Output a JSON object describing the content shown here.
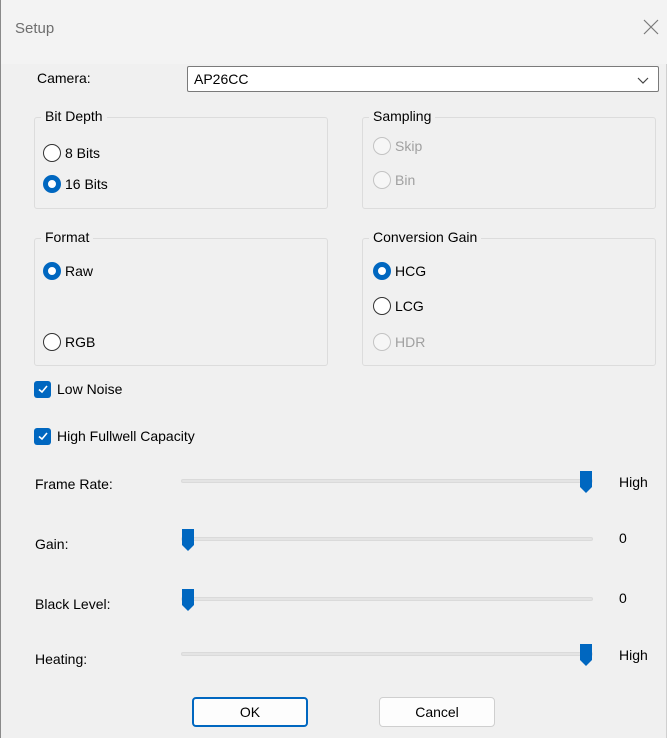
{
  "window": {
    "title": "Setup"
  },
  "camera": {
    "label": "Camera:",
    "value": "AP26CC"
  },
  "bit_depth": {
    "legend": "Bit Depth",
    "options": [
      {
        "label": "8 Bits",
        "checked": false
      },
      {
        "label": "16 Bits",
        "checked": true
      }
    ]
  },
  "sampling": {
    "legend": "Sampling",
    "options": [
      {
        "label": "Skip",
        "enabled": false
      },
      {
        "label": "Bin",
        "enabled": false
      }
    ]
  },
  "format": {
    "legend": "Format",
    "options": [
      {
        "label": "Raw",
        "checked": true
      },
      {
        "label": "RGB",
        "checked": false
      }
    ]
  },
  "conversion_gain": {
    "legend": "Conversion Gain",
    "options": [
      {
        "label": "HCG",
        "checked": true
      },
      {
        "label": "LCG",
        "checked": false
      },
      {
        "label": "HDR",
        "checked": false,
        "enabled": false
      }
    ]
  },
  "checkboxes": {
    "low_noise": {
      "label": "Low Noise",
      "checked": true
    },
    "high_fullwell": {
      "label": "High Fullwell Capacity",
      "checked": true
    }
  },
  "sliders": {
    "frame_rate": {
      "label": "Frame Rate:",
      "value_text": "High",
      "level": 1.0
    },
    "gain": {
      "label": "Gain:",
      "value_text": "0",
      "level": 0.0
    },
    "black_level": {
      "label": "Black Level:",
      "value_text": "0",
      "level": 0.0
    },
    "heating": {
      "label": "Heating:",
      "value_text": "High",
      "level": 1.0
    }
  },
  "buttons": {
    "ok": "OK",
    "cancel": "Cancel"
  },
  "colors": {
    "accent": "#0067c0",
    "background": "#f0f0f0"
  }
}
